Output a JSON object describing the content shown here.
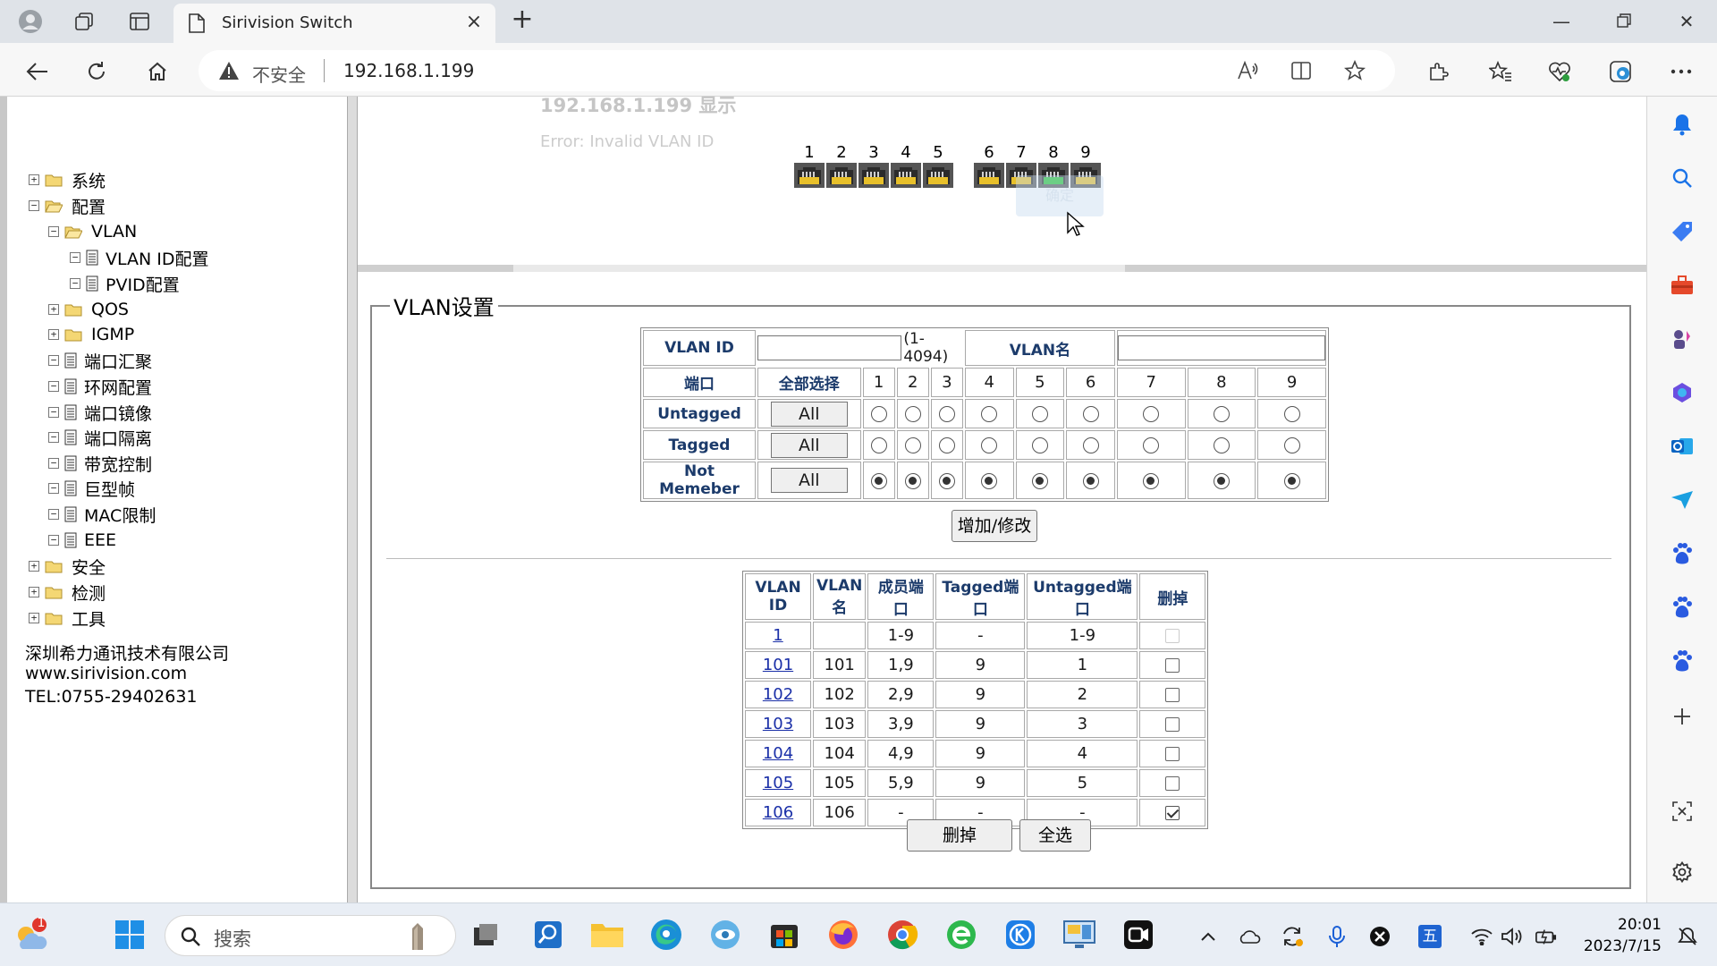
{
  "browser": {
    "tab_title": "Sirivision Switch",
    "not_secure": "不安全",
    "url": "192.168.1.199"
  },
  "tree": {
    "nodes": [
      {
        "label": "系统",
        "exp": "+"
      },
      {
        "label": "配置",
        "exp": "−"
      },
      {
        "label": "VLAN",
        "exp": "−"
      },
      {
        "label": "VLAN ID配置",
        "exp": "−"
      },
      {
        "label": "PVID配置",
        "exp": "−"
      },
      {
        "label": "QOS",
        "exp": "+"
      },
      {
        "label": "IGMP",
        "exp": "+"
      },
      {
        "label": "端口汇聚",
        "exp": "−"
      },
      {
        "label": "环网配置",
        "exp": "−"
      },
      {
        "label": "端口镜像",
        "exp": "−"
      },
      {
        "label": "端口隔离",
        "exp": "−"
      },
      {
        "label": "带宽控制",
        "exp": "−"
      },
      {
        "label": "巨型帧",
        "exp": "−"
      },
      {
        "label": "MAC限制",
        "exp": "−"
      },
      {
        "label": "EEE",
        "exp": "−"
      },
      {
        "label": "安全",
        "exp": "+"
      },
      {
        "label": "检测",
        "exp": "+"
      },
      {
        "label": "工具",
        "exp": "+"
      }
    ]
  },
  "company": {
    "name": "深圳希力通讯技术有限公司",
    "site": "www.sirivision.com",
    "tel": "TEL:0755-29402631"
  },
  "ports": {
    "numbers": [
      "1",
      "2",
      "3",
      "4",
      "5",
      "6",
      "7",
      "8",
      "9"
    ],
    "active_port": 8,
    "active_color": "#22c32e",
    "idle_color": "#e8c02a"
  },
  "dialog": {
    "title": "192.168.1.199 显示",
    "message": "Error: Invalid VLAN ID",
    "ok": "确定"
  },
  "vlan_settings": {
    "legend": "VLAN设置",
    "vlan_id_label": "VLAN ID",
    "vlan_id_value": "",
    "vlan_id_range": "(1-4094)",
    "vlan_name_label": "VLAN名",
    "vlan_name_value": "",
    "port_label": "端口",
    "select_all_label": "全部选择",
    "rows": [
      {
        "label": "Untagged",
        "all": "All",
        "checked": [
          false,
          false,
          false,
          false,
          false,
          false,
          false,
          false,
          false
        ]
      },
      {
        "label": "Tagged",
        "all": "All",
        "checked": [
          false,
          false,
          false,
          false,
          false,
          false,
          false,
          false,
          false
        ]
      },
      {
        "label": "Not Memeber",
        "all": "All",
        "checked": [
          true,
          true,
          true,
          true,
          true,
          true,
          true,
          true,
          true
        ]
      }
    ],
    "submit": "增加/修改"
  },
  "vlan_list": {
    "headers": [
      "VLAN ID",
      "VLAN名",
      "成员端口",
      "Tagged端口",
      "Untagged端口",
      "删掉"
    ],
    "rows": [
      {
        "id": "1",
        "name": "",
        "members": "1-9",
        "tagged": "-",
        "untagged": "1-9",
        "del": "disabled"
      },
      {
        "id": "101",
        "name": "101",
        "members": "1,9",
        "tagged": "9",
        "untagged": "1",
        "del": "off"
      },
      {
        "id": "102",
        "name": "102",
        "members": "2,9",
        "tagged": "9",
        "untagged": "2",
        "del": "off"
      },
      {
        "id": "103",
        "name": "103",
        "members": "3,9",
        "tagged": "9",
        "untagged": "3",
        "del": "off"
      },
      {
        "id": "104",
        "name": "104",
        "members": "4,9",
        "tagged": "9",
        "untagged": "4",
        "del": "off"
      },
      {
        "id": "105",
        "name": "105",
        "members": "5,9",
        "tagged": "9",
        "untagged": "5",
        "del": "off"
      },
      {
        "id": "106",
        "name": "106",
        "members": "-",
        "tagged": "-",
        "untagged": "-",
        "del": "on"
      }
    ],
    "delete_btn": "删掉",
    "select_all_btn": "全选"
  },
  "taskbar": {
    "search_placeholder": "搜索",
    "badge": "1",
    "ime": "五",
    "time": "20:01",
    "date": "2023/7/15"
  }
}
